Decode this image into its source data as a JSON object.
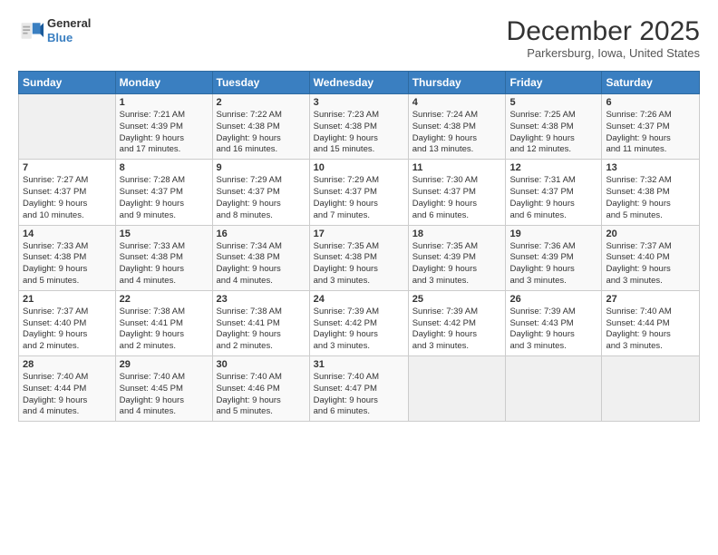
{
  "header": {
    "logo_line1": "General",
    "logo_line2": "Blue",
    "month": "December 2025",
    "location": "Parkersburg, Iowa, United States"
  },
  "weekdays": [
    "Sunday",
    "Monday",
    "Tuesday",
    "Wednesday",
    "Thursday",
    "Friday",
    "Saturday"
  ],
  "weeks": [
    [
      {
        "day": "",
        "info": ""
      },
      {
        "day": "1",
        "info": "Sunrise: 7:21 AM\nSunset: 4:39 PM\nDaylight: 9 hours\nand 17 minutes."
      },
      {
        "day": "2",
        "info": "Sunrise: 7:22 AM\nSunset: 4:38 PM\nDaylight: 9 hours\nand 16 minutes."
      },
      {
        "day": "3",
        "info": "Sunrise: 7:23 AM\nSunset: 4:38 PM\nDaylight: 9 hours\nand 15 minutes."
      },
      {
        "day": "4",
        "info": "Sunrise: 7:24 AM\nSunset: 4:38 PM\nDaylight: 9 hours\nand 13 minutes."
      },
      {
        "day": "5",
        "info": "Sunrise: 7:25 AM\nSunset: 4:38 PM\nDaylight: 9 hours\nand 12 minutes."
      },
      {
        "day": "6",
        "info": "Sunrise: 7:26 AM\nSunset: 4:37 PM\nDaylight: 9 hours\nand 11 minutes."
      }
    ],
    [
      {
        "day": "7",
        "info": "Sunrise: 7:27 AM\nSunset: 4:37 PM\nDaylight: 9 hours\nand 10 minutes."
      },
      {
        "day": "8",
        "info": "Sunrise: 7:28 AM\nSunset: 4:37 PM\nDaylight: 9 hours\nand 9 minutes."
      },
      {
        "day": "9",
        "info": "Sunrise: 7:29 AM\nSunset: 4:37 PM\nDaylight: 9 hours\nand 8 minutes."
      },
      {
        "day": "10",
        "info": "Sunrise: 7:29 AM\nSunset: 4:37 PM\nDaylight: 9 hours\nand 7 minutes."
      },
      {
        "day": "11",
        "info": "Sunrise: 7:30 AM\nSunset: 4:37 PM\nDaylight: 9 hours\nand 6 minutes."
      },
      {
        "day": "12",
        "info": "Sunrise: 7:31 AM\nSunset: 4:37 PM\nDaylight: 9 hours\nand 6 minutes."
      },
      {
        "day": "13",
        "info": "Sunrise: 7:32 AM\nSunset: 4:38 PM\nDaylight: 9 hours\nand 5 minutes."
      }
    ],
    [
      {
        "day": "14",
        "info": "Sunrise: 7:33 AM\nSunset: 4:38 PM\nDaylight: 9 hours\nand 5 minutes."
      },
      {
        "day": "15",
        "info": "Sunrise: 7:33 AM\nSunset: 4:38 PM\nDaylight: 9 hours\nand 4 minutes."
      },
      {
        "day": "16",
        "info": "Sunrise: 7:34 AM\nSunset: 4:38 PM\nDaylight: 9 hours\nand 4 minutes."
      },
      {
        "day": "17",
        "info": "Sunrise: 7:35 AM\nSunset: 4:38 PM\nDaylight: 9 hours\nand 3 minutes."
      },
      {
        "day": "18",
        "info": "Sunrise: 7:35 AM\nSunset: 4:39 PM\nDaylight: 9 hours\nand 3 minutes."
      },
      {
        "day": "19",
        "info": "Sunrise: 7:36 AM\nSunset: 4:39 PM\nDaylight: 9 hours\nand 3 minutes."
      },
      {
        "day": "20",
        "info": "Sunrise: 7:37 AM\nSunset: 4:40 PM\nDaylight: 9 hours\nand 3 minutes."
      }
    ],
    [
      {
        "day": "21",
        "info": "Sunrise: 7:37 AM\nSunset: 4:40 PM\nDaylight: 9 hours\nand 2 minutes."
      },
      {
        "day": "22",
        "info": "Sunrise: 7:38 AM\nSunset: 4:41 PM\nDaylight: 9 hours\nand 2 minutes."
      },
      {
        "day": "23",
        "info": "Sunrise: 7:38 AM\nSunset: 4:41 PM\nDaylight: 9 hours\nand 2 minutes."
      },
      {
        "day": "24",
        "info": "Sunrise: 7:39 AM\nSunset: 4:42 PM\nDaylight: 9 hours\nand 3 minutes."
      },
      {
        "day": "25",
        "info": "Sunrise: 7:39 AM\nSunset: 4:42 PM\nDaylight: 9 hours\nand 3 minutes."
      },
      {
        "day": "26",
        "info": "Sunrise: 7:39 AM\nSunset: 4:43 PM\nDaylight: 9 hours\nand 3 minutes."
      },
      {
        "day": "27",
        "info": "Sunrise: 7:40 AM\nSunset: 4:44 PM\nDaylight: 9 hours\nand 3 minutes."
      }
    ],
    [
      {
        "day": "28",
        "info": "Sunrise: 7:40 AM\nSunset: 4:44 PM\nDaylight: 9 hours\nand 4 minutes."
      },
      {
        "day": "29",
        "info": "Sunrise: 7:40 AM\nSunset: 4:45 PM\nDaylight: 9 hours\nand 4 minutes."
      },
      {
        "day": "30",
        "info": "Sunrise: 7:40 AM\nSunset: 4:46 PM\nDaylight: 9 hours\nand 5 minutes."
      },
      {
        "day": "31",
        "info": "Sunrise: 7:40 AM\nSunset: 4:47 PM\nDaylight: 9 hours\nand 6 minutes."
      },
      {
        "day": "",
        "info": ""
      },
      {
        "day": "",
        "info": ""
      },
      {
        "day": "",
        "info": ""
      }
    ]
  ]
}
